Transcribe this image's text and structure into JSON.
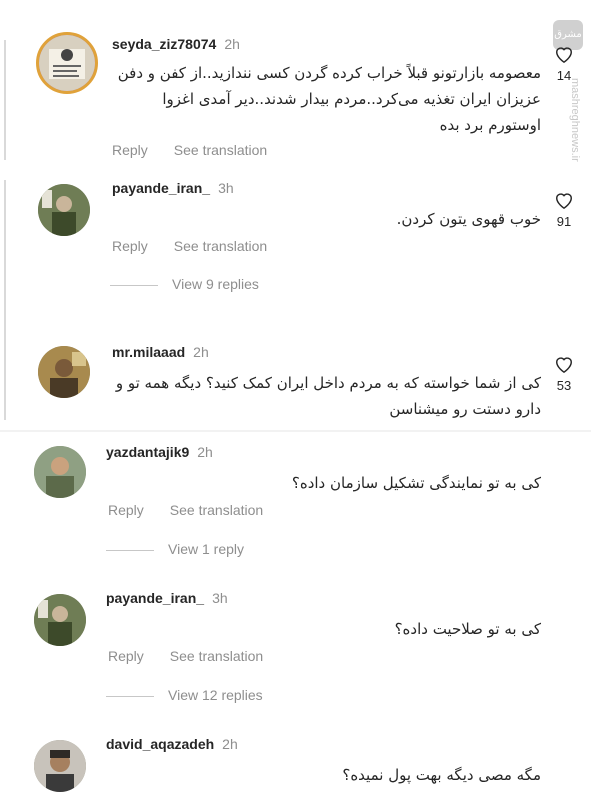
{
  "watermark": {
    "logo_text": "مشرق",
    "site": "mashreghnews.ir"
  },
  "icons": {
    "like": "heart-outline-icon"
  },
  "comments": [
    {
      "username": "seyda_ziz78074",
      "time": "2h",
      "text": "معصومه بازارتونو قبلاً خراب کرده گردن کسی نندازید..از کفن و دفن عزیزان ایران تغذیه می‌کرد..مردم بیدار شدند..دیر آمدی اغزوا اوستورم برد بده",
      "reply_label": "Reply",
      "translate_label": "See translation",
      "likes": "14"
    },
    {
      "username": "payande_iran_",
      "time": "3h",
      "text": "خوب قهوی یتون  کردن.",
      "reply_label": "Reply",
      "translate_label": "See translation",
      "likes": "91",
      "view_replies": "View 9 replies"
    },
    {
      "username": "mr.milaaad",
      "time": "2h",
      "text": "کی از شما خواسته که به مردم داخل ایران کمک کنید؟ دیگه همه تو و دارو دستت رو میشناسن",
      "likes": "53"
    },
    {
      "username": "yazdantajik9",
      "time": "2h",
      "text": "کی به تو نمایندگی تشکیل سازمان داده؟",
      "reply_label": "Reply",
      "translate_label": "See translation",
      "view_replies": "View 1 reply"
    },
    {
      "username": "payande_iran_",
      "time": "3h",
      "text": "کی به تو صلاحیت داده؟",
      "reply_label": "Reply",
      "translate_label": "See translation",
      "view_replies": "View 12 replies"
    },
    {
      "username": "david_aqazadeh",
      "time": "2h",
      "text": "مگه مصی دیگه بهت پول نمیده؟"
    }
  ]
}
